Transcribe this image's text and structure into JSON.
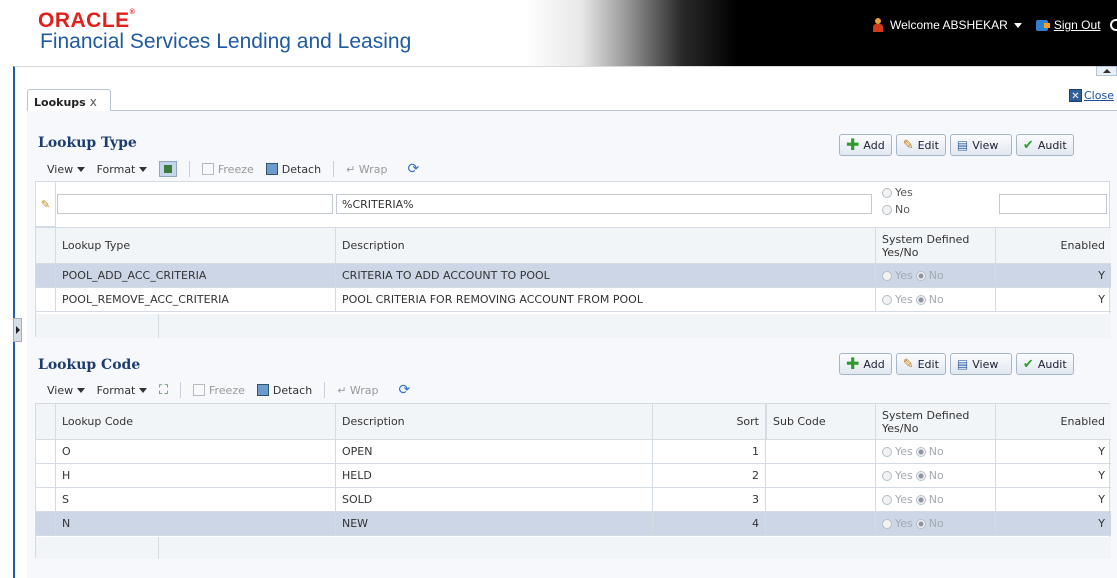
{
  "header": {
    "brand": "ORACLE",
    "product": "Financial Services Lending and Leasing",
    "welcome": "Welcome ABSHEKAR",
    "sign_out": "Sign Out"
  },
  "tab": {
    "label": "Lookups",
    "close_glyph": "x"
  },
  "close_link": "Close",
  "buttons": {
    "add": "Add",
    "edit": "Edit",
    "view": "View",
    "audit": "Audit"
  },
  "toolbar": {
    "view": "View",
    "format": "Format",
    "freeze": "Freeze",
    "detach": "Detach",
    "wrap": "Wrap"
  },
  "lookup_type": {
    "title": "Lookup Type",
    "filter": {
      "description": "%CRITERIA%",
      "yes": "Yes",
      "no": "No"
    },
    "columns": {
      "type": "Lookup Type",
      "description": "Description",
      "system": "System Defined Yes/No",
      "enabled": "Enabled"
    },
    "rows": [
      {
        "type": "POOL_ADD_ACC_CRITERIA",
        "description": "CRITERIA TO ADD ACCOUNT TO POOL",
        "yes": "Yes",
        "no": "No",
        "enabled": "Y",
        "selected": true
      },
      {
        "type": "POOL_REMOVE_ACC_CRITERIA",
        "description": "POOL CRITERIA FOR REMOVING ACCOUNT FROM POOL",
        "yes": "Yes",
        "no": "No",
        "enabled": "Y",
        "selected": false
      }
    ]
  },
  "lookup_code": {
    "title": "Lookup Code",
    "columns": {
      "code": "Lookup Code",
      "description": "Description",
      "sort": "Sort",
      "sub_code": "Sub Code",
      "system": "System Defined Yes/No",
      "enabled": "Enabled"
    },
    "rows": [
      {
        "code": "O",
        "description": "OPEN",
        "sort": "1",
        "sub_code": "",
        "yes": "Yes",
        "no": "No",
        "enabled": "Y",
        "selected": false
      },
      {
        "code": "H",
        "description": "HELD",
        "sort": "2",
        "sub_code": "",
        "yes": "Yes",
        "no": "No",
        "enabled": "Y",
        "selected": false
      },
      {
        "code": "S",
        "description": "SOLD",
        "sort": "3",
        "sub_code": "",
        "yes": "Yes",
        "no": "No",
        "enabled": "Y",
        "selected": false
      },
      {
        "code": "N",
        "description": "NEW",
        "sort": "4",
        "sub_code": "",
        "yes": "Yes",
        "no": "No",
        "enabled": "Y",
        "selected": true
      }
    ]
  },
  "colors": {
    "brand_red": "#e0201b",
    "product_blue": "#1f5aa0",
    "title_navy": "#1d3d6d",
    "selected_row": "#ccd6e6",
    "frame_blue": "#1b5fb5"
  },
  "icons": [
    "user-icon",
    "signout-icon",
    "close-window-icon",
    "add-icon",
    "edit-icon",
    "view-icon",
    "audit-icon",
    "filter-icon",
    "freeze-icon",
    "detach-icon",
    "wrap-icon",
    "refresh-icon",
    "pencil-icon"
  ]
}
